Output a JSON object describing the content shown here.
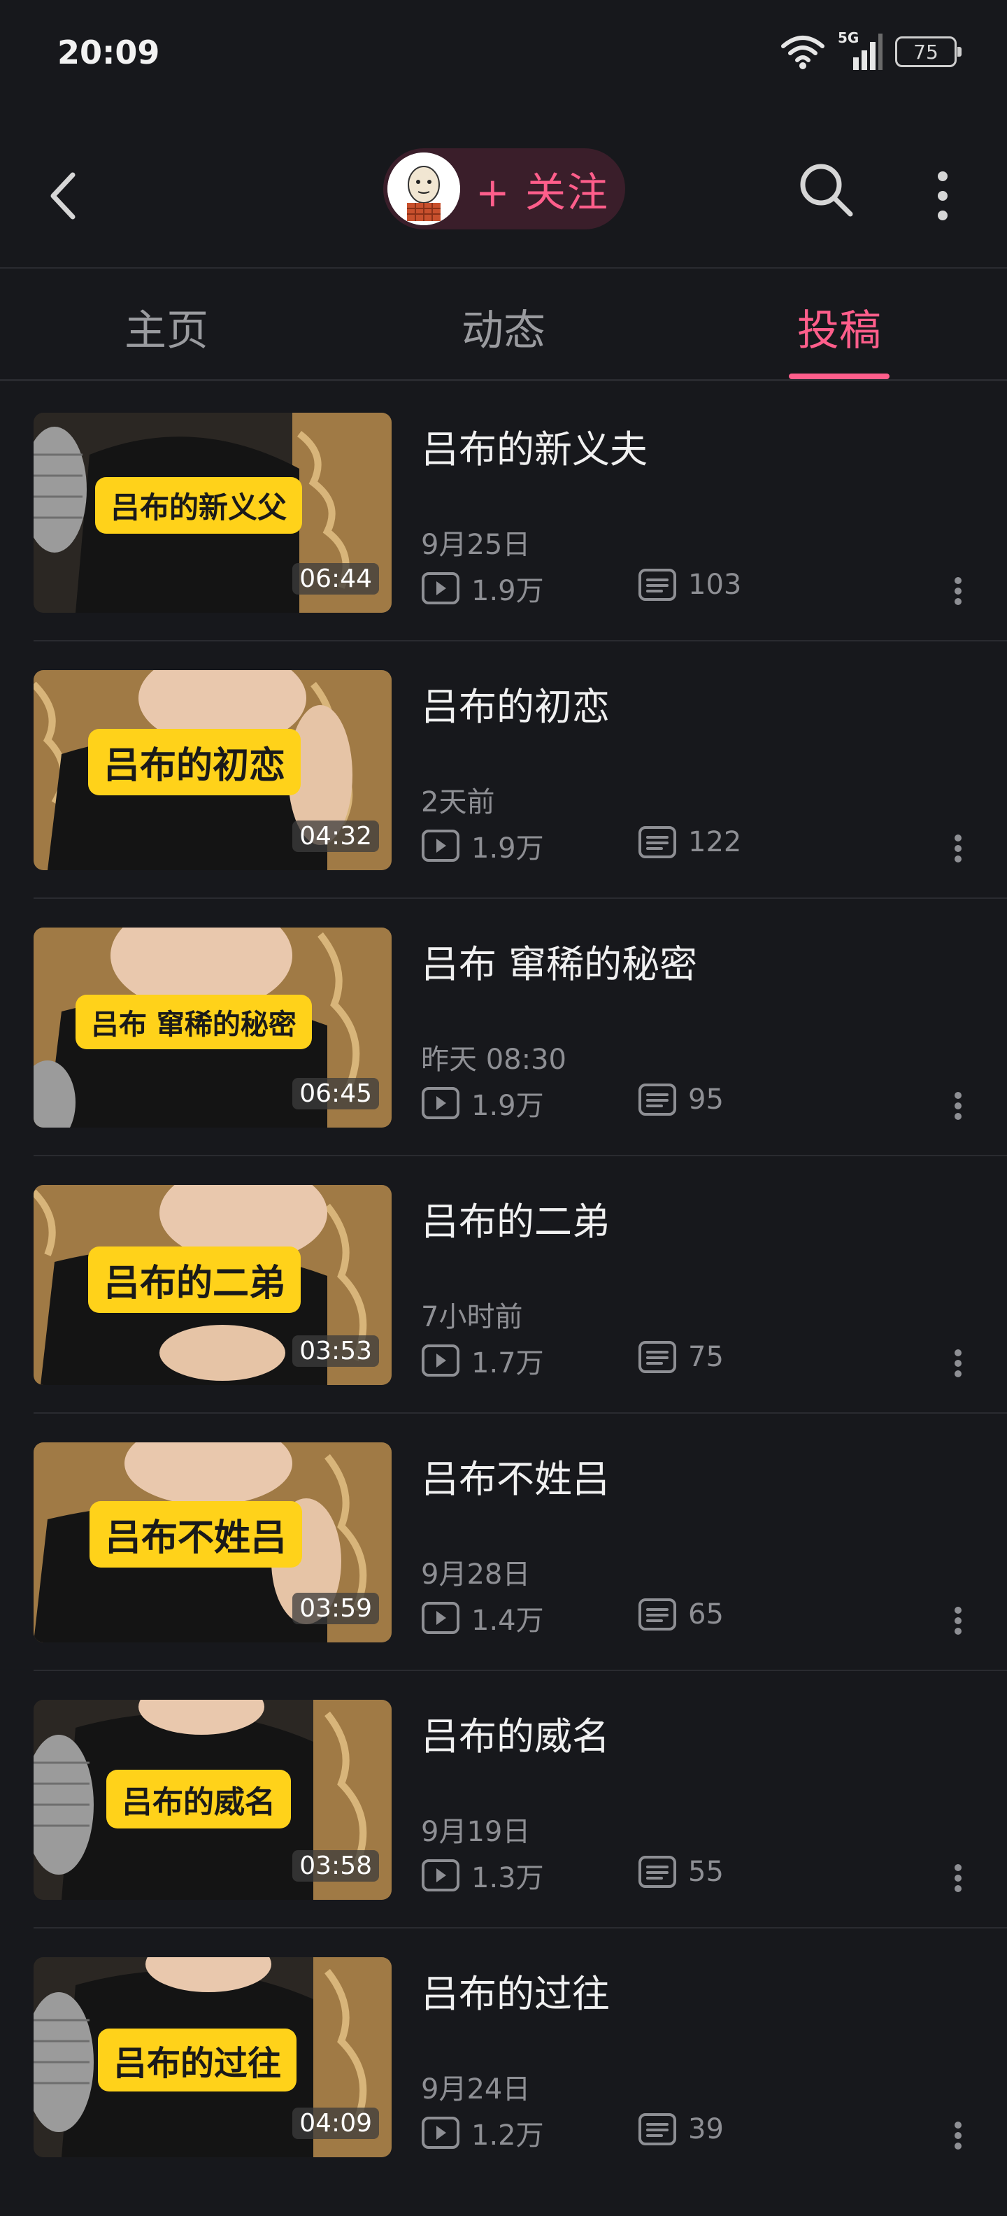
{
  "status_bar": {
    "time": "20:09",
    "network": "5G",
    "battery": "75"
  },
  "header": {
    "follow_label": "+ 关注",
    "icons": [
      "back-arrow-icon",
      "avatar",
      "search-icon",
      "more-vertical-icon"
    ]
  },
  "tabs": [
    {
      "label": "主页",
      "active": false
    },
    {
      "label": "动态",
      "active": false
    },
    {
      "label": "投稿",
      "active": true
    }
  ],
  "colors": {
    "accent": "#ff5e8b",
    "background": "#17181c",
    "caption_bg": "#ffd21a",
    "muted_text": "#8e8f94"
  },
  "videos": [
    {
      "title": "吕布的新义夫",
      "thumb_caption": "吕布的新义父",
      "duration": "06:44",
      "date": "9月25日",
      "views": "1.9万",
      "comments": "103"
    },
    {
      "title": "吕布的初恋",
      "thumb_caption": "吕布的初恋",
      "duration": "04:32",
      "date": "2天前",
      "views": "1.9万",
      "comments": "122"
    },
    {
      "title": "吕布 窜稀的秘密",
      "thumb_caption": "吕布 窜稀的秘密",
      "duration": "06:45",
      "date": "昨天 08:30",
      "views": "1.9万",
      "comments": "95"
    },
    {
      "title": "吕布的二弟",
      "thumb_caption": "吕布的二弟",
      "duration": "03:53",
      "date": "7小时前",
      "views": "1.7万",
      "comments": "75"
    },
    {
      "title": "吕布不姓吕",
      "thumb_caption": "吕布不姓吕",
      "duration": "03:59",
      "date": "9月28日",
      "views": "1.4万",
      "comments": "65"
    },
    {
      "title": "吕布的威名",
      "thumb_caption": "吕布的威名",
      "duration": "03:58",
      "date": "9月19日",
      "views": "1.3万",
      "comments": "55"
    },
    {
      "title": "吕布的过往",
      "thumb_caption": "吕布的过往",
      "duration": "04:09",
      "date": "9月24日",
      "views": "1.2万",
      "comments": "39"
    }
  ]
}
